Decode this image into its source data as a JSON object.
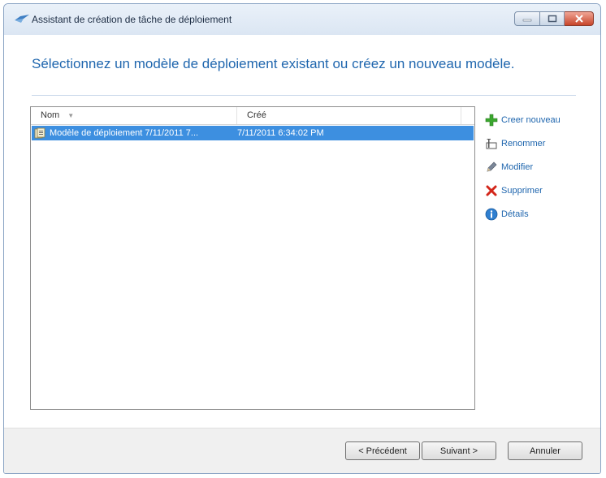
{
  "window": {
    "title": "Assistant de création de tâche de déploiement"
  },
  "heading": "Sélectionnez un modèle de déploiement existant ou créez un nouveau modèle.",
  "table": {
    "columns": [
      "Nom",
      "Créé"
    ],
    "rows": [
      {
        "name": "Modèle de déploiement 7/11/2011 7...",
        "created": "7/11/2011 6:34:02 PM"
      }
    ]
  },
  "actions": [
    {
      "label": "Creer nouveau",
      "icon": "plus-icon"
    },
    {
      "label": "Renommer",
      "icon": "rename-icon"
    },
    {
      "label": "Modifier",
      "icon": "pencil-icon"
    },
    {
      "label": "Supprimer",
      "icon": "delete-x-icon"
    },
    {
      "label": "Détails",
      "icon": "info-icon"
    }
  ],
  "buttons": {
    "previous": "< Précédent",
    "next": "Suivant >",
    "cancel": "Annuler"
  },
  "colors": {
    "accent": "#1f66ae",
    "selection": "#3d8fe0",
    "plus": "#3aa72e",
    "delete": "#d3261a"
  }
}
